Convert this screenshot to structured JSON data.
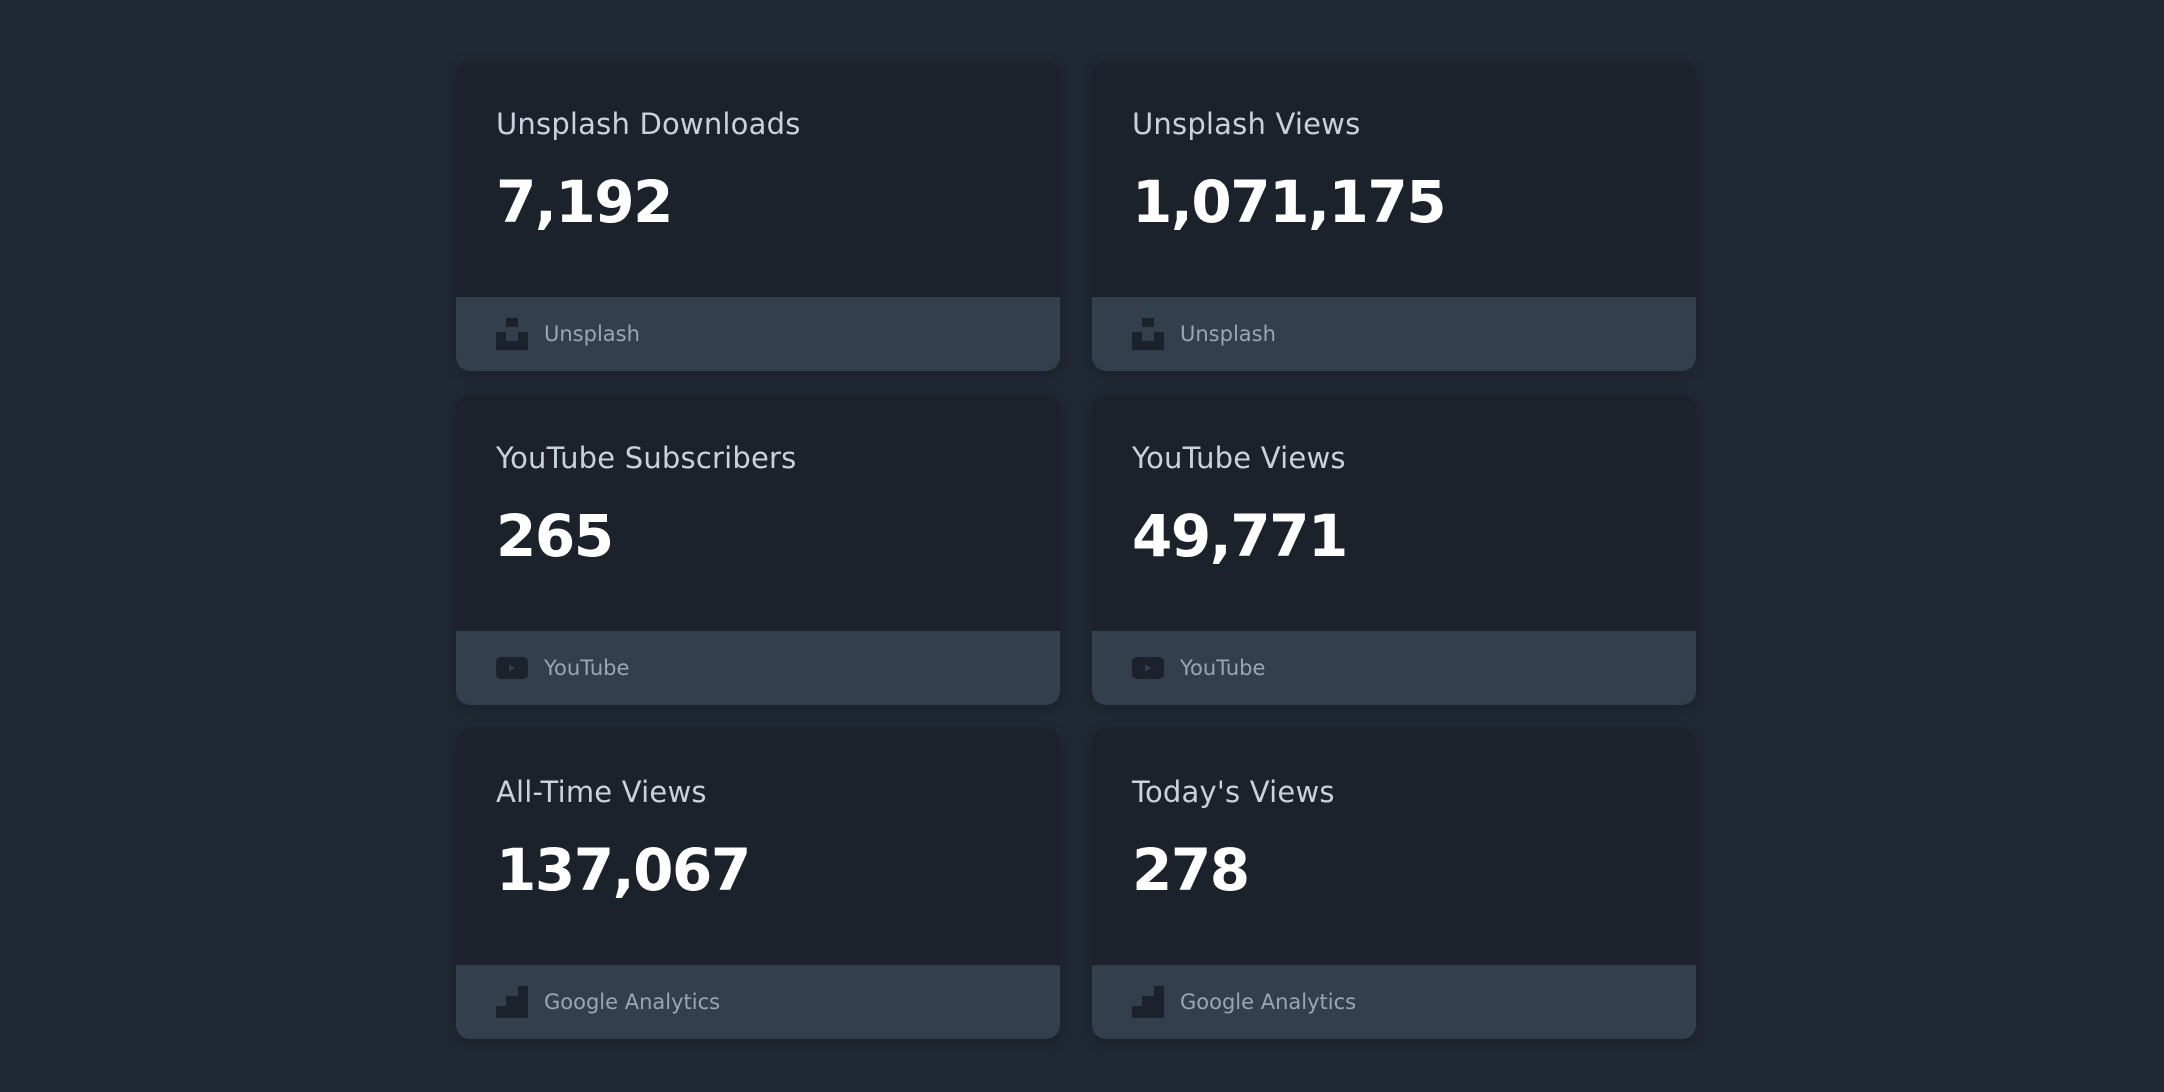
{
  "cards": [
    {
      "title": "Unsplash Downloads",
      "value": "7,192",
      "source": "Unsplash",
      "icon": "unsplash-icon"
    },
    {
      "title": "Unsplash Views",
      "value": "1,071,175",
      "source": "Unsplash",
      "icon": "unsplash-icon"
    },
    {
      "title": "YouTube Subscribers",
      "value": "265",
      "source": "YouTube",
      "icon": "youtube-icon"
    },
    {
      "title": "YouTube Views",
      "value": "49,771",
      "source": "YouTube",
      "icon": "youtube-icon"
    },
    {
      "title": "All-Time Views",
      "value": "137,067",
      "source": "Google Analytics",
      "icon": "google-analytics-icon"
    },
    {
      "title": "Today's Views",
      "value": "278",
      "source": "Google Analytics",
      "icon": "google-analytics-icon"
    }
  ],
  "colors": {
    "page_background": "#202833",
    "card_background": "#1c222b",
    "footer_background": "#333f4d",
    "title_text": "#c9d1dc",
    "value_text": "#ffffff",
    "source_text": "#9aa6b4",
    "icon_fill": "#1c222b"
  }
}
